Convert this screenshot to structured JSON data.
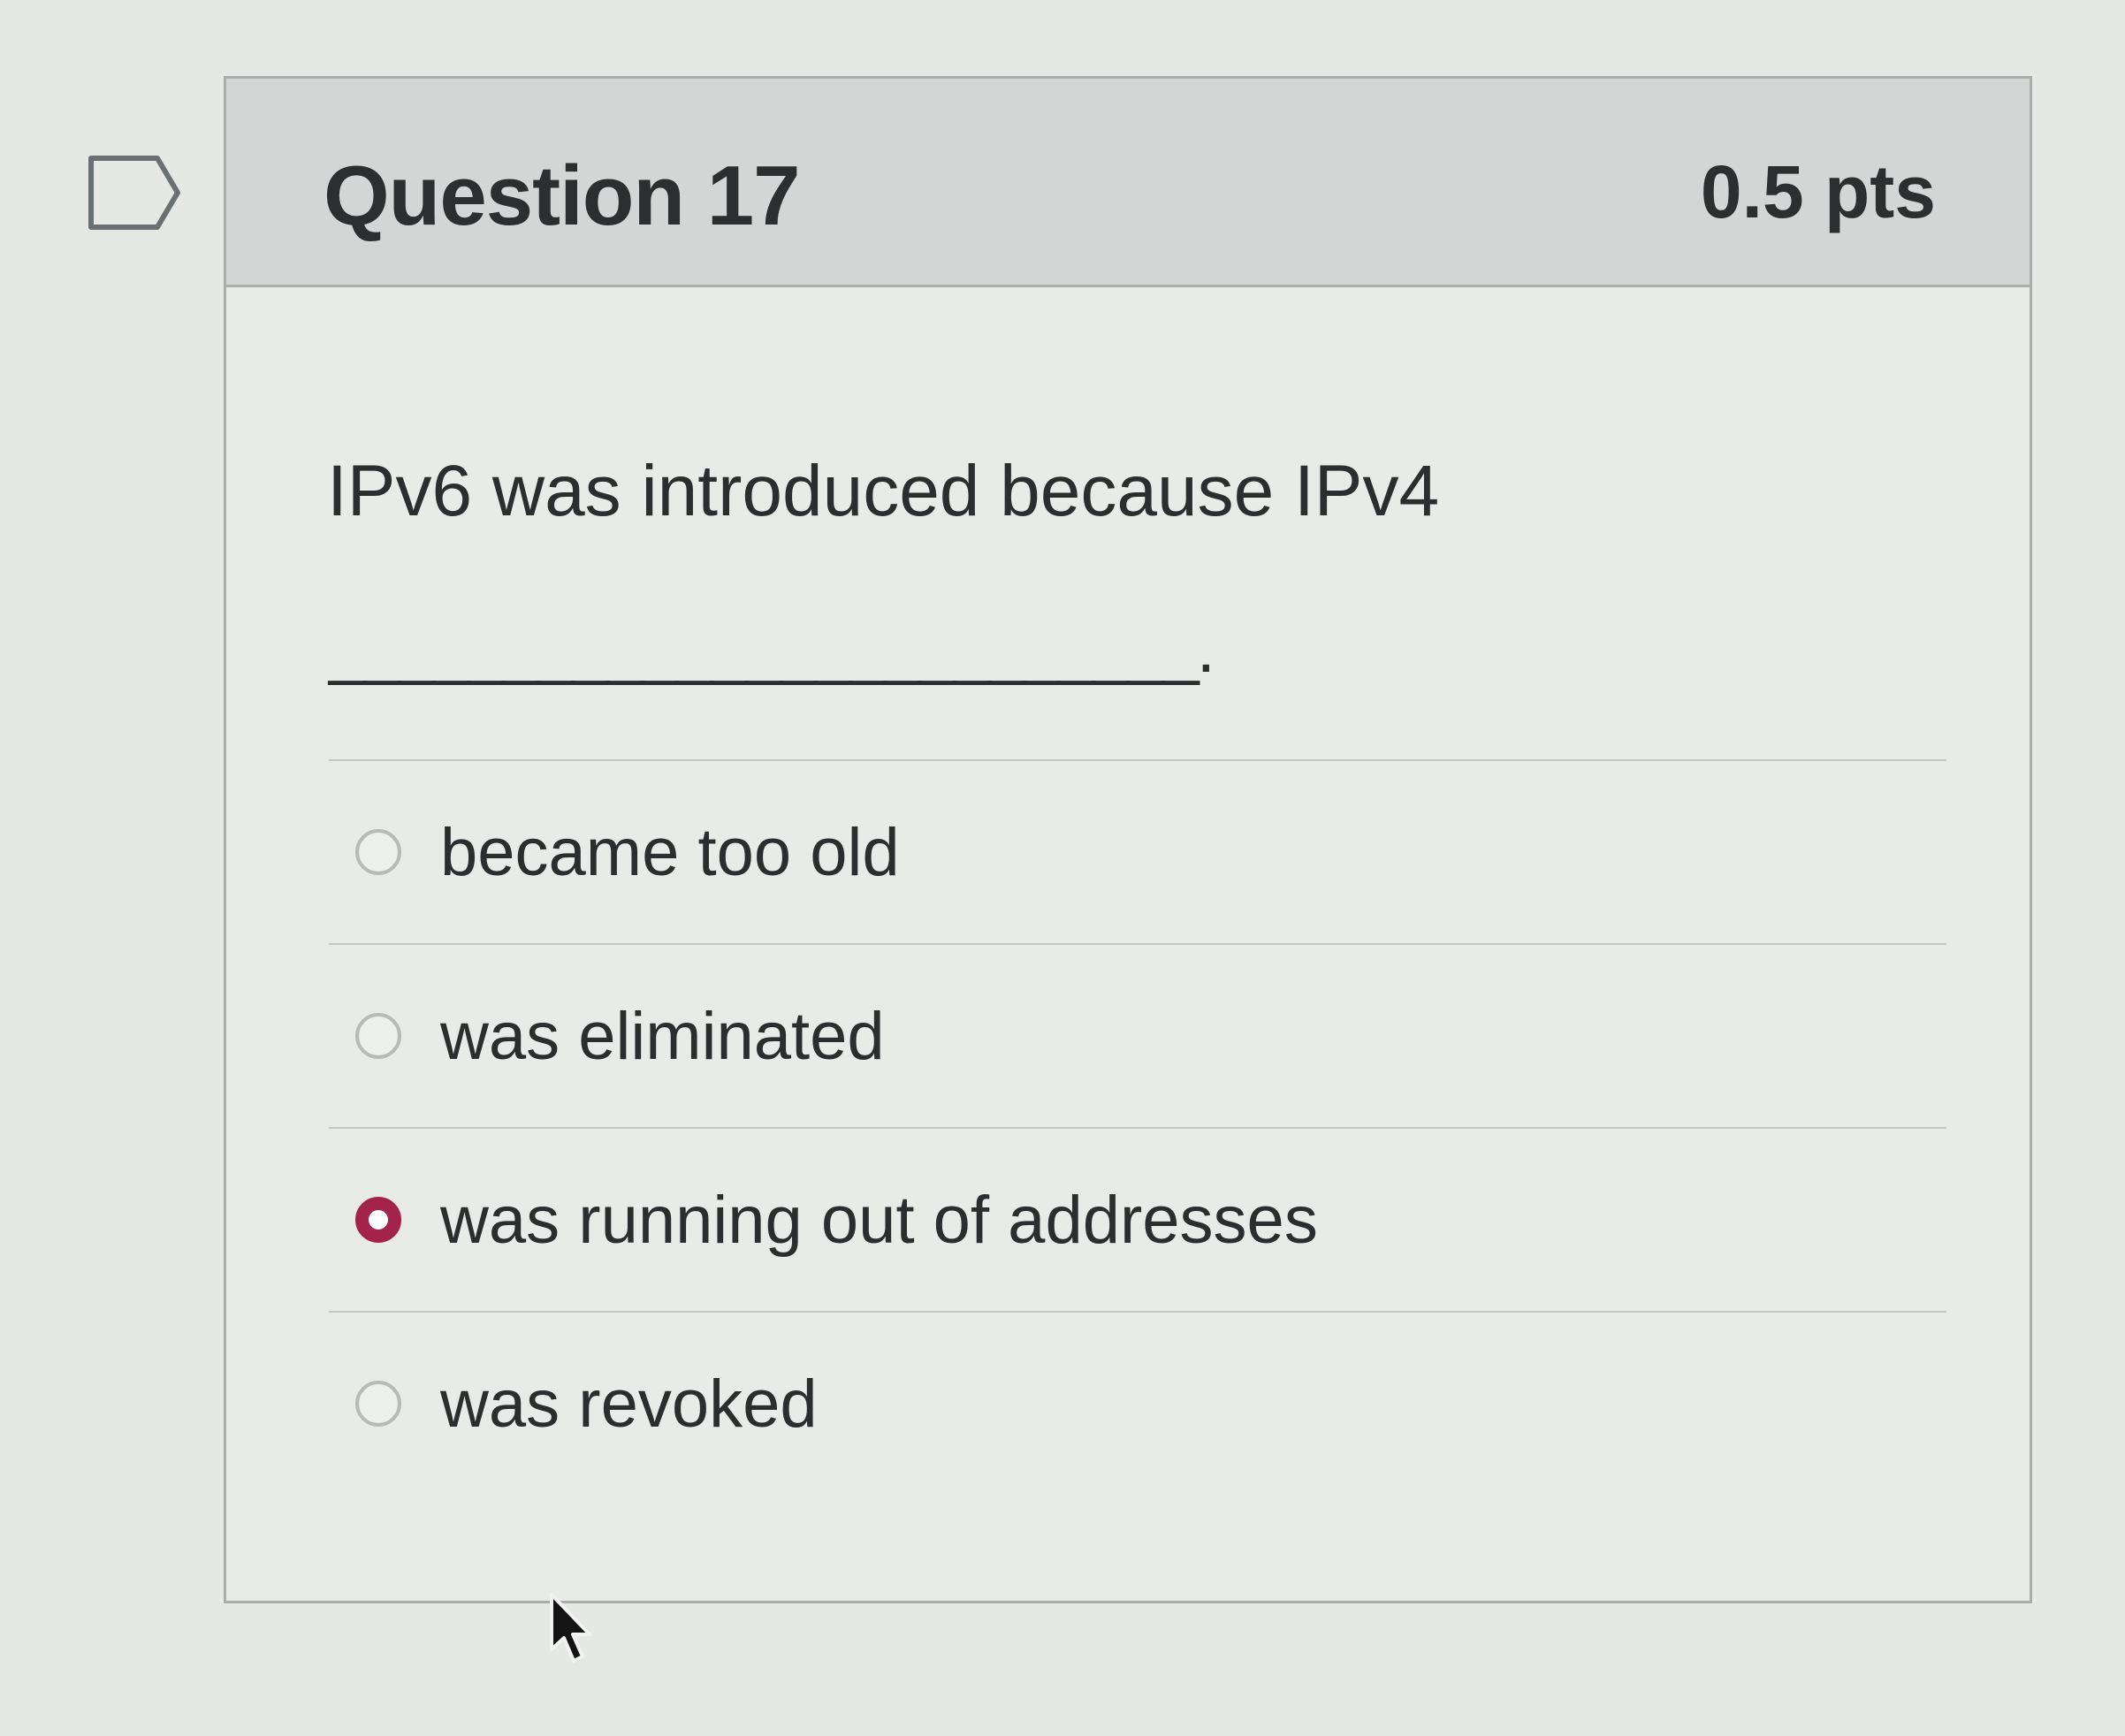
{
  "question": {
    "title": "Question 17",
    "points": "0.5 pts",
    "text": "IPv6 was introduced because IPv4",
    "blank": "_________________________."
  },
  "answers": [
    {
      "label": "became too old",
      "selected": false
    },
    {
      "label": "was eliminated",
      "selected": false
    },
    {
      "label": "was running out of addresses",
      "selected": true
    },
    {
      "label": "was revoked",
      "selected": false
    }
  ],
  "colors": {
    "selected_radio": "#a3234c",
    "header_background": "#d3d6d4",
    "card_border": "#a9adab"
  },
  "icons": {
    "flag": "flag-question-icon",
    "cursor": "mouse-pointer-icon"
  }
}
